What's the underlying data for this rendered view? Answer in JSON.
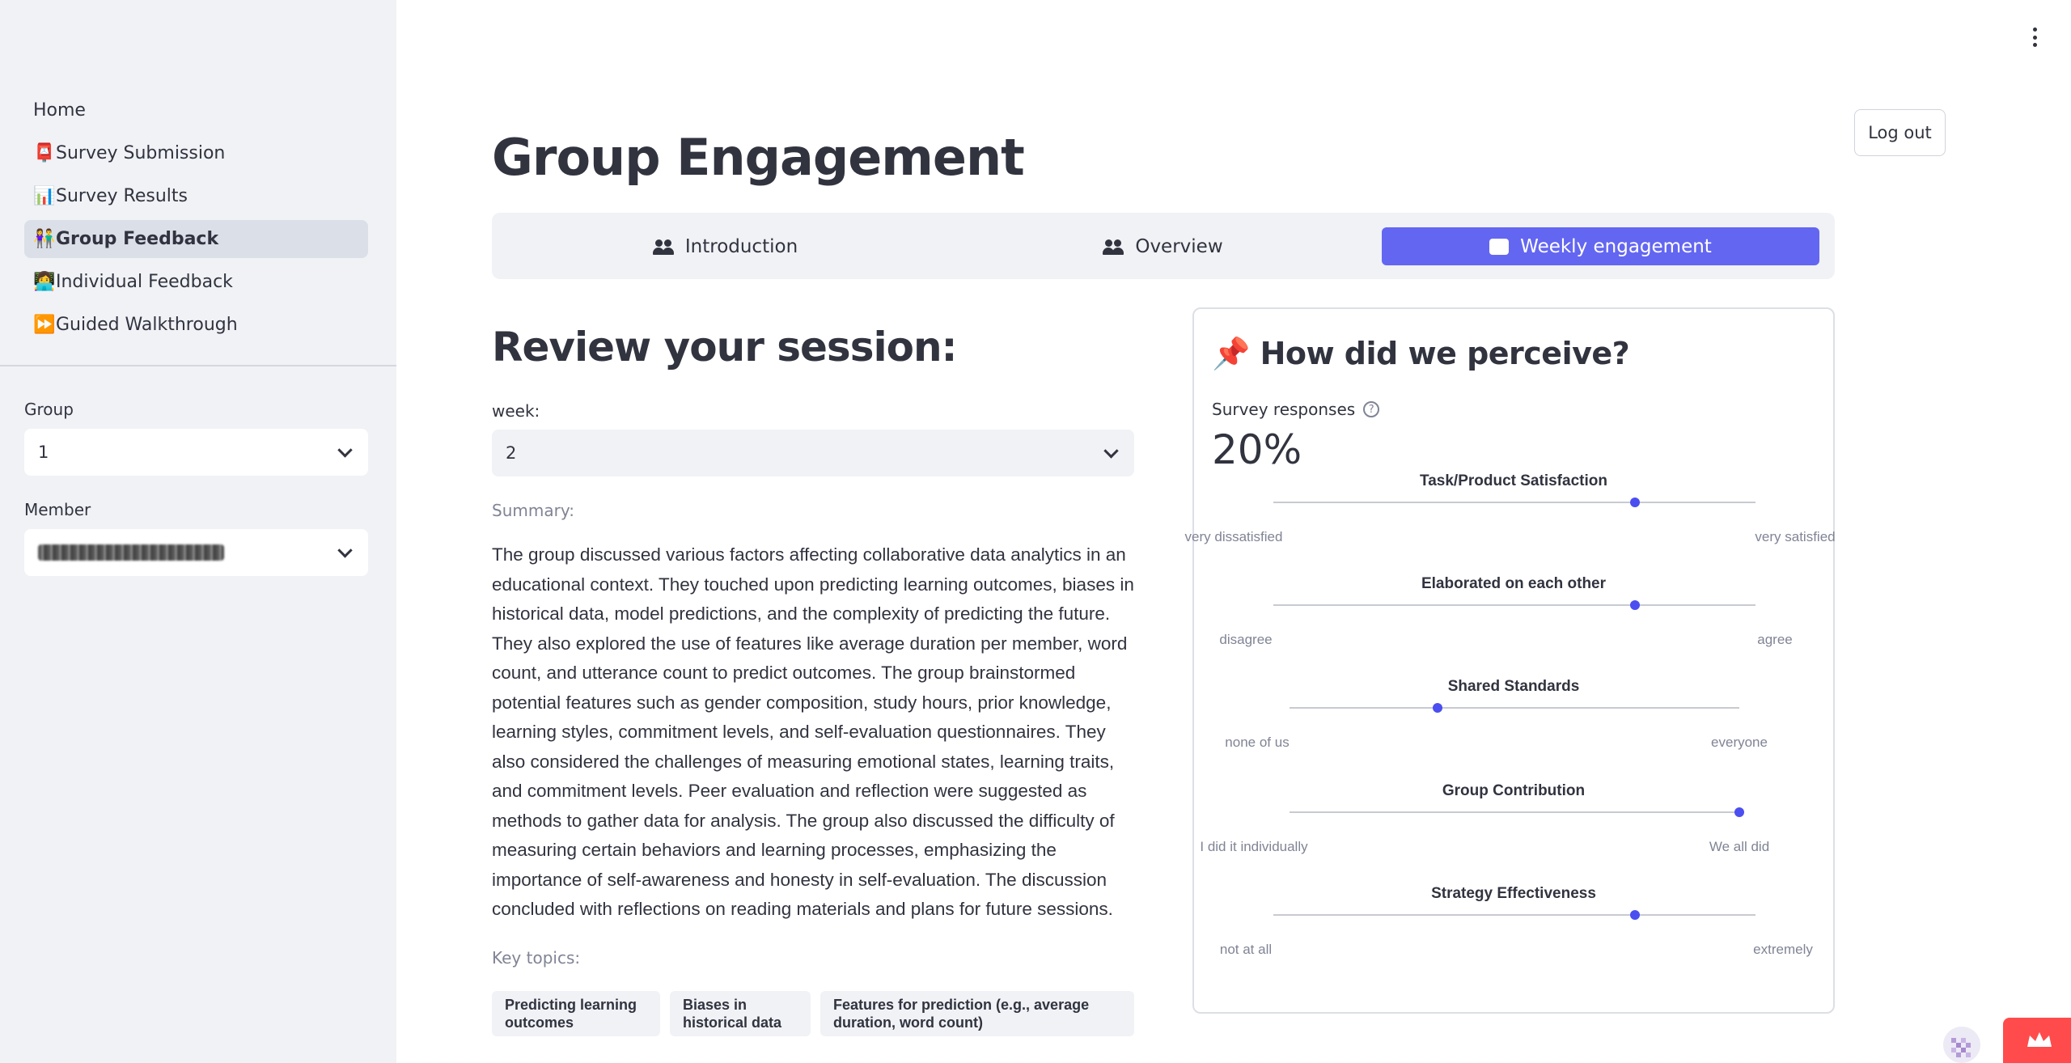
{
  "sidebar": {
    "nav": [
      {
        "emoji": "📮",
        "label": "Home",
        "show_emoji": false
      },
      {
        "emoji": "📮",
        "label": "Survey Submission",
        "show_emoji": true
      },
      {
        "emoji": "📊",
        "label": "Survey Results",
        "show_emoji": true
      },
      {
        "emoji": "👫",
        "label": "Group Feedback",
        "show_emoji": true,
        "active": true
      },
      {
        "emoji": "👩‍💻",
        "label": "Individual Feedback",
        "show_emoji": true
      },
      {
        "emoji": "⏩",
        "label": "Guided Walkthrough",
        "show_emoji": true
      }
    ],
    "group_label": "Group",
    "group_value": "1",
    "member_label": "Member"
  },
  "header": {
    "logout_label": "Log out"
  },
  "page": {
    "title": "Group Engagement",
    "tabs": [
      {
        "label": "Introduction"
      },
      {
        "label": "Overview"
      },
      {
        "label": "Weekly engagement",
        "active": true
      }
    ]
  },
  "review": {
    "heading": "Review your session:",
    "week_label": "week:",
    "week_value": "2",
    "summary_label": "Summary:",
    "summary_text": "The group discussed various factors affecting collaborative data analytics in an educational context. They touched upon predicting learning outcomes, biases in historical data, model predictions, and the complexity of predicting the future. They also explored the use of features like average duration per member, word count, and utterance count to predict outcomes. The group brainstormed potential features such as gender composition, study hours, prior knowledge, learning styles, commitment levels, and self-evaluation questionnaires. They also considered the challenges of measuring emotional states, learning traits, and commitment levels. Peer evaluation and reflection were suggested as methods to gather data for analysis. The group also discussed the difficulty of measuring certain behaviors and learning processes, emphasizing the importance of self-awareness and honesty in self-evaluation. The discussion concluded with reflections on reading materials and plans for future sessions.",
    "topics_label": "Key topics:",
    "topics": [
      "Predicting learning outcomes",
      "Biases in historical data",
      "Features for prediction (e.g., average duration, word count)"
    ]
  },
  "perception": {
    "emoji": "📌",
    "title": "How did we perceive?",
    "responses_label": "Survey responses",
    "responses_value": "20%",
    "sliders": [
      {
        "title": "Task/Product Satisfaction",
        "left": "very dissatisfied",
        "right": "very satisfied",
        "value": 0.75
      },
      {
        "title": "Elaborated on each other",
        "left": "disagree",
        "right": "agree",
        "value": 0.75
      },
      {
        "title": "Shared Standards",
        "left": "none of us",
        "right": "everyone",
        "value": 0.33
      },
      {
        "title": "Group Contribution",
        "left": "I did it individually",
        "right": "We all did",
        "value": 1.0
      },
      {
        "title": "Strategy Effectiveness",
        "left": "not at all",
        "right": "extremely",
        "value": 0.75
      }
    ]
  },
  "colors": {
    "accent": "#6366f1",
    "slider_dot": "#4b4ef0",
    "sidebar_bg": "#f0f2f6",
    "streamlit_red": "#ff4b4b"
  }
}
